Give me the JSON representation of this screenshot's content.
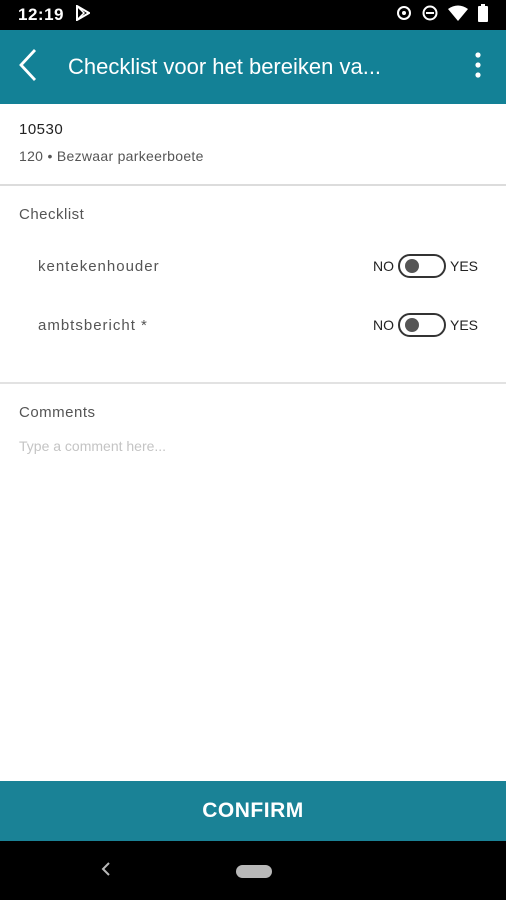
{
  "status_bar": {
    "time": "12:19",
    "icons": [
      "play-store-icon",
      "sync-icon",
      "do-not-disturb-icon",
      "wifi-icon",
      "battery-icon"
    ]
  },
  "app_bar": {
    "title": "Checklist voor het bereiken va...",
    "back_icon": "back-arrow-icon",
    "menu_icon": "more-vert-icon",
    "color": "#138196"
  },
  "case": {
    "id": "10530",
    "subtitle": "120 • Bezwaar parkeerboete"
  },
  "checklist": {
    "title": "Checklist",
    "items": [
      {
        "label": "kentekenhouder",
        "no_label": "NO",
        "yes_label": "YES",
        "value": "NO"
      },
      {
        "label": "ambtsbericht *",
        "no_label": "NO",
        "yes_label": "YES",
        "value": "NO"
      }
    ]
  },
  "comments": {
    "title": "Comments",
    "placeholder": "Type a comment here...",
    "value": ""
  },
  "confirm": {
    "label": "CONFIRM",
    "color": "#1a8296"
  }
}
